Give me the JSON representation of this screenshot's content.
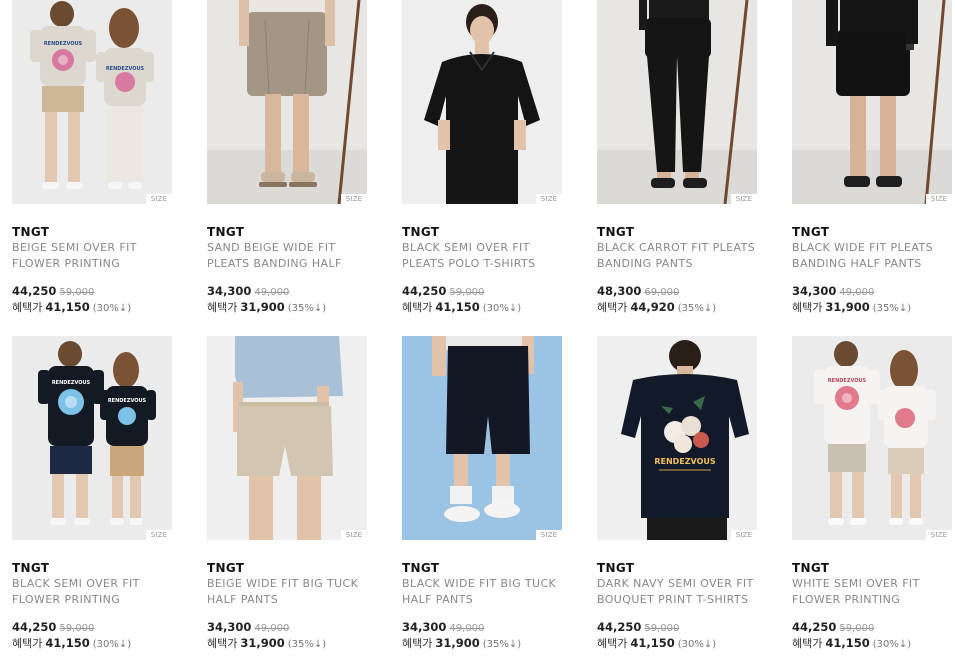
{
  "products": [
    {
      "brand": "TNGT",
      "name1": "BEIGE SEMI OVER FIT",
      "name2": "FLOWER PRINTING",
      "price": "44,250",
      "original": "59,000",
      "benefit_label": "혜택가",
      "benefit_price": "41,150",
      "rate": "(30%↓)",
      "size": "SIZE",
      "image": "beige-flower-tee-couple"
    },
    {
      "brand": "TNGT",
      "name1": "SAND BEIGE WIDE FIT",
      "name2": "PLEATS BANDING HALF",
      "price": "34,300",
      "original": "49,000",
      "benefit_label": "혜택가",
      "benefit_price": "31,900",
      "rate": "(35%↓)",
      "size": "SIZE",
      "image": "sand-beige-shorts"
    },
    {
      "brand": "TNGT",
      "name1": "BLACK SEMI OVER FIT",
      "name2": "PLEATS POLO T-SHIRTS",
      "price": "44,250",
      "original": "59,000",
      "benefit_label": "혜택가",
      "benefit_price": "41,150",
      "rate": "(30%↓)",
      "size": "SIZE",
      "image": "black-polo"
    },
    {
      "brand": "TNGT",
      "name1": "BLACK CARROT FIT PLEATS",
      "name2": "BANDING PANTS",
      "price": "48,300",
      "original": "69,000",
      "benefit_label": "혜택가",
      "benefit_price": "44,920",
      "rate": "(35%↓)",
      "size": "SIZE",
      "image": "black-carrot-pants"
    },
    {
      "brand": "TNGT",
      "name1": "BLACK WIDE FIT PLEATS",
      "name2": "BANDING HALF PANTS",
      "price": "34,300",
      "original": "49,000",
      "benefit_label": "혜택가",
      "benefit_price": "31,900",
      "rate": "(35%↓)",
      "size": "SIZE",
      "image": "black-half-pants"
    },
    {
      "brand": "TNGT",
      "name1": "BLACK SEMI OVER FIT",
      "name2": "FLOWER PRINTING",
      "price": "44,250",
      "original": "59,000",
      "benefit_label": "혜택가",
      "benefit_price": "41,150",
      "rate": "(30%↓)",
      "size": "SIZE",
      "image": "black-flower-tee-couple"
    },
    {
      "brand": "TNGT",
      "name1": "BEIGE WIDE FIT BIG TUCK",
      "name2": "HALF PANTS",
      "price": "34,300",
      "original": "49,000",
      "benefit_label": "혜택가",
      "benefit_price": "31,900",
      "rate": "(35%↓)",
      "size": "SIZE",
      "image": "beige-tuck-shorts"
    },
    {
      "brand": "TNGT",
      "name1": "BLACK WIDE FIT BIG TUCK",
      "name2": "HALF PANTS",
      "price": "34,300",
      "original": "49,000",
      "benefit_label": "혜택가",
      "benefit_price": "31,900",
      "rate": "(35%↓)",
      "size": "SIZE",
      "image": "black-tuck-shorts-blue"
    },
    {
      "brand": "TNGT",
      "name1": "DARK NAVY SEMI OVER FIT",
      "name2": "BOUQUET PRINT T-SHIRTS",
      "price": "44,250",
      "original": "59,000",
      "benefit_label": "혜택가",
      "benefit_price": "41,150",
      "rate": "(30%↓)",
      "size": "SIZE",
      "image": "navy-bouquet-tee"
    },
    {
      "brand": "TNGT",
      "name1": "WHITE SEMI OVER FIT",
      "name2": "FLOWER PRINTING",
      "price": "44,250",
      "original": "59,000",
      "benefit_label": "혜택가",
      "benefit_price": "41,150",
      "rate": "(30%↓)",
      "size": "SIZE",
      "image": "white-flower-tee-couple"
    }
  ],
  "image_text": {
    "tee_print": "RENDEZVOUS"
  }
}
